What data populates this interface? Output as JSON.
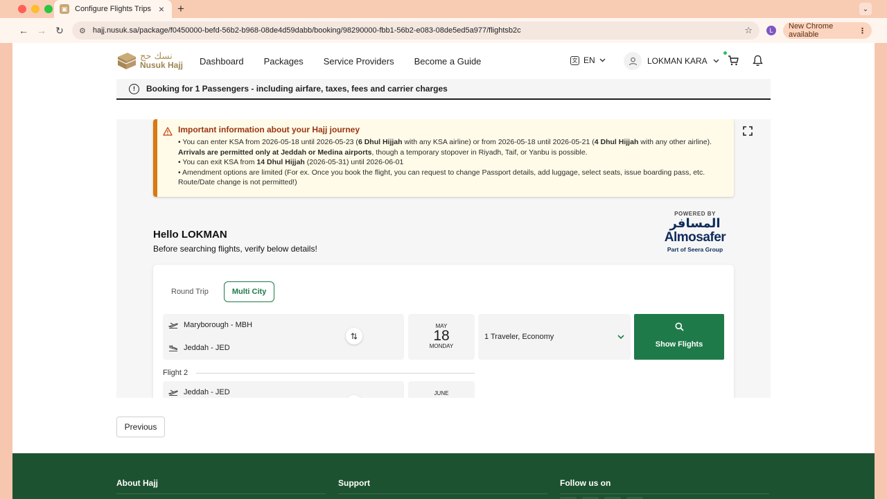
{
  "browser": {
    "tab_title": "Configure Flights Trips",
    "url": "hajj.nusuk.sa/package/f0450000-befd-56b2-b968-08de4d59dabb/booking/98290000-fbb1-56b2-e083-08de5ed5a977/flightsb2c",
    "profile_initial": "L",
    "update_label": "New Chrome available"
  },
  "header": {
    "logo_ar": "نسك حج",
    "logo_en": "Nusuk Hajj",
    "nav": [
      "Dashboard",
      "Packages",
      "Service Providers",
      "Become a Guide"
    ],
    "language": "EN",
    "user_name": "LOKMAN KARA"
  },
  "booking_banner": "Booking for 1 Passengers - including airfare, taxes, fees and carrier charges",
  "alert": {
    "title": "Important information about your Hajj journey",
    "line1_a": "• You can enter KSA from 2026-05-18 until 2026-05-23 (",
    "line1_b": "6 Dhul Hijjah",
    "line1_c": " with any KSA airline) or from 2026-05-18 until 2026-05-21 (",
    "line1_d": "4 Dhul Hijjah",
    "line1_e": " with any other airline).",
    "line2_a": "Arrivals are permitted only at Jeddah or Medina airports",
    "line2_b": ", though a temporary stopover in Riyadh, Taif, or Yanbu is possible.",
    "line3_a": "• You can exit KSA from ",
    "line3_b": "14 Dhul Hijjah",
    "line3_c": " (2026-05-31) until 2026-06-01",
    "line4": "• Amendment options are limited (For ex. Once you book the flight, you can request to change Passport details, add luggage, select seats, issue boarding pass, etc.",
    "line5": "Route/Date change is not permitted!)"
  },
  "greeting": {
    "hello": "Hello LOKMAN",
    "subtitle": "Before searching flights, verify below details!"
  },
  "powered_by": {
    "label": "POWERED BY",
    "brand_ar": "المسافر",
    "brand_en": "Almosafer",
    "group": "Part of Seera Group"
  },
  "search": {
    "trip_types": [
      "Round Trip",
      "Multi City"
    ],
    "selected_trip_type": "Multi City",
    "flight1": {
      "from": "Maryborough - MBH",
      "to": "Jeddah - JED",
      "month": "MAY",
      "day": "18",
      "weekday": "MONDAY"
    },
    "travelers": "1 Traveler, Economy",
    "show_flights": "Show Flights",
    "flight2": {
      "label": "Flight 2",
      "from": "Jeddah - JED",
      "month": "JUNE"
    }
  },
  "previous_label": "Previous",
  "footer": {
    "about": "About Hajj",
    "support": "Support",
    "follow": "Follow us on"
  },
  "colors": {
    "brand_green": "#1f7a4a",
    "footer_green": "#1d5230",
    "alert_orange": "#d9790f",
    "gold": "#b08d57"
  }
}
